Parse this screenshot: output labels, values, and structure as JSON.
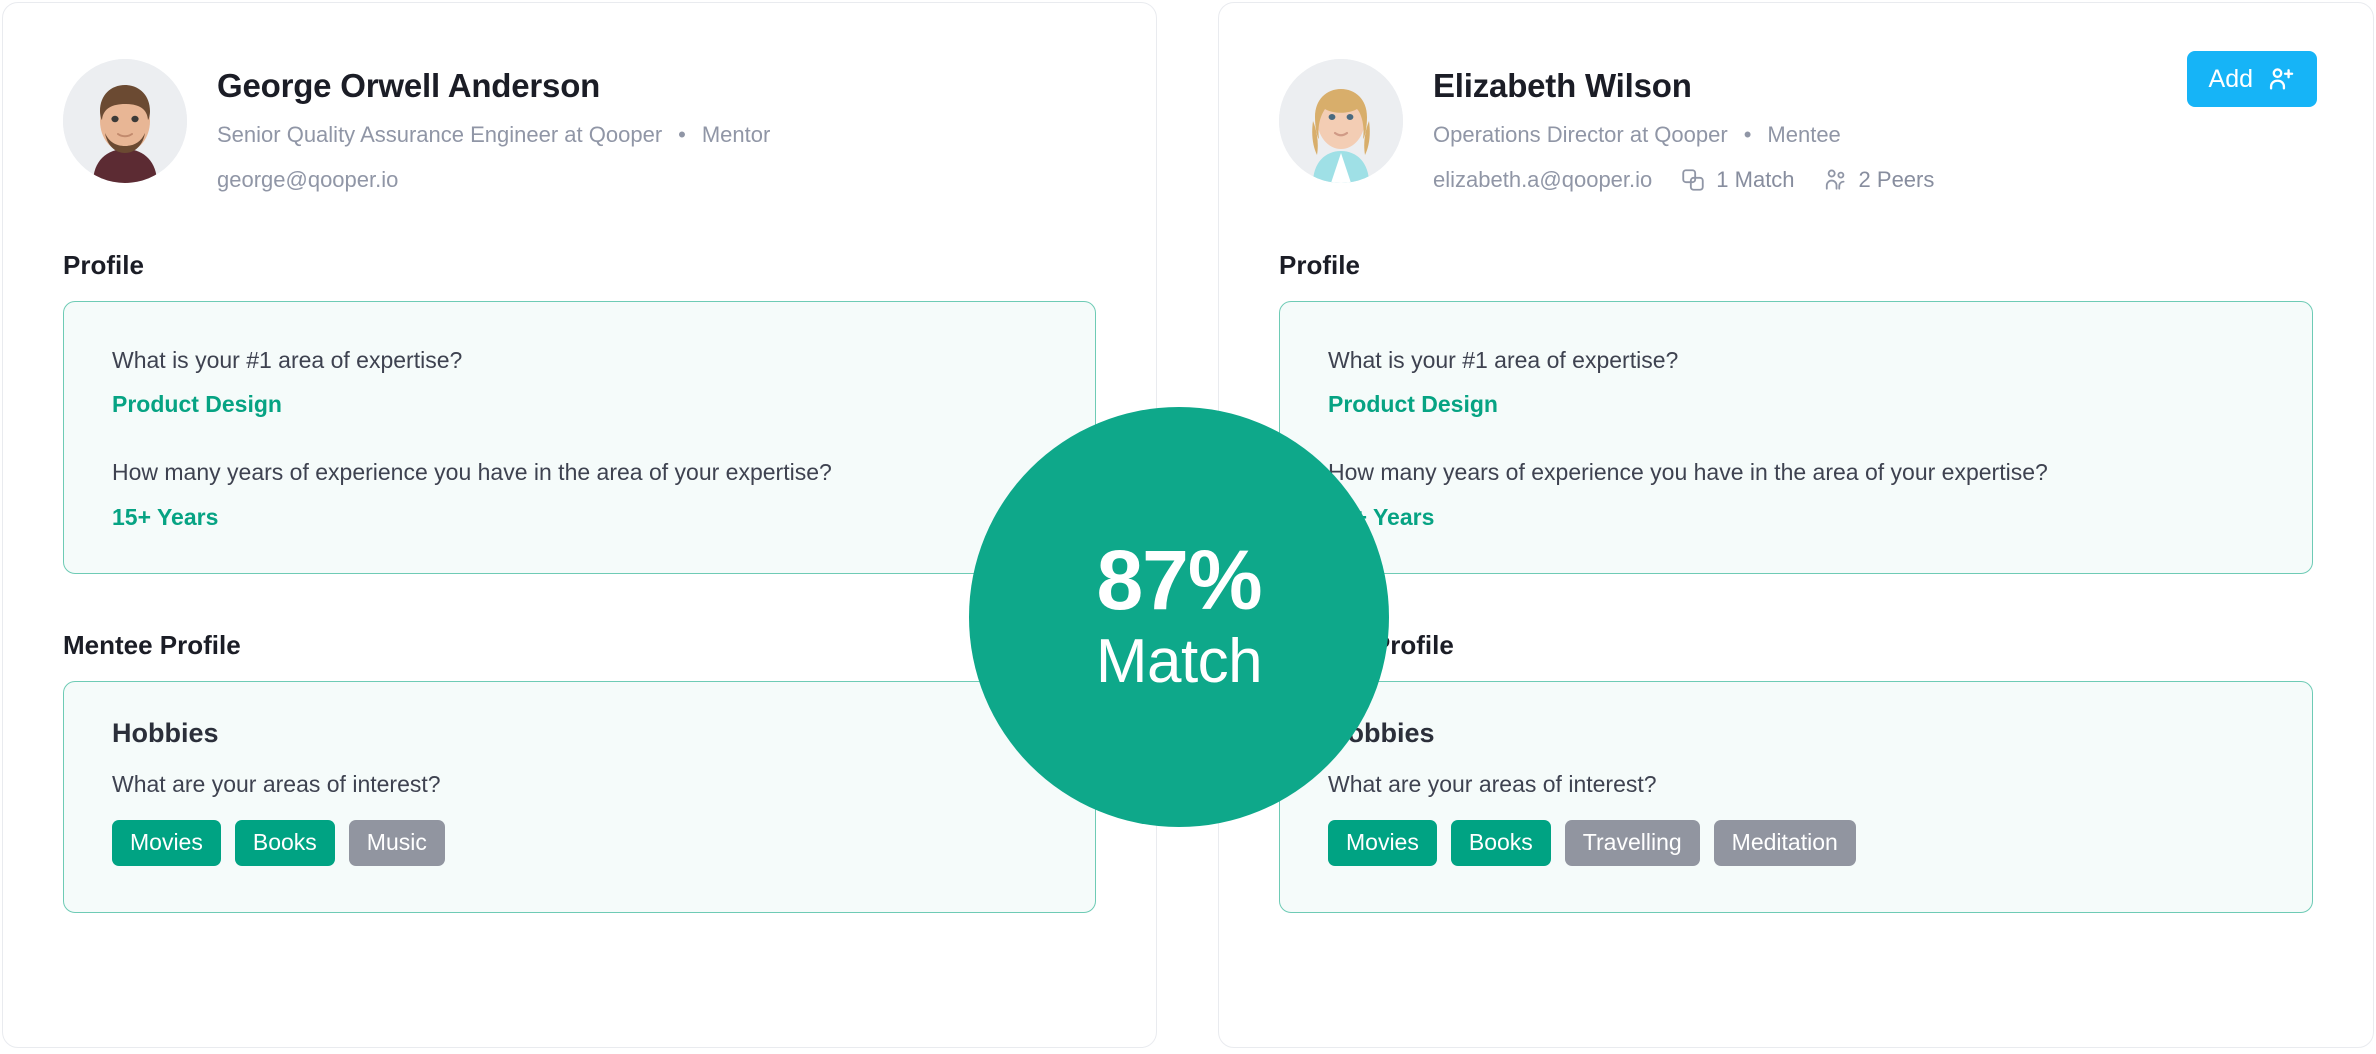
{
  "colors": {
    "accent_teal": "#0ea88a",
    "tag_match": "#00a383",
    "tag_plain": "#9195a0",
    "add_button_blue": "#16b4f7",
    "qbox_border": "#6ecbb5",
    "qbox_bg": "#f5fbfa",
    "muted_text": "#9096a6"
  },
  "match": {
    "percent": "87%",
    "label": "Match"
  },
  "left_card": {
    "name": "George Orwell Anderson",
    "title": "Senior Quality Assurance Engineer at Qooper",
    "separator": "•",
    "role": "Mentor",
    "email": "george@qooper.io",
    "profile_section_title": "Profile",
    "profile_questions": [
      {
        "question": "What is your #1 area of expertise?",
        "answer": "Product Design"
      },
      {
        "question": "How many years of experience you have in the area of your expertise?",
        "answer": "15+ Years"
      }
    ],
    "counterpart_section_title": "Mentee Profile",
    "hobbies": {
      "title": "Hobbies",
      "question": "What are your areas of interest?",
      "tags": [
        {
          "label": "Movies",
          "matched": true
        },
        {
          "label": "Books",
          "matched": true
        },
        {
          "label": "Music",
          "matched": false
        }
      ]
    }
  },
  "right_card": {
    "name": "Elizabeth Wilson",
    "title": "Operations Director at Qooper",
    "separator": "•",
    "role": "Mentee",
    "email": "elizabeth.a@qooper.io",
    "stats": [
      {
        "icon": "match-icon",
        "label": "1 Match"
      },
      {
        "icon": "peers-icon",
        "label": "2 Peers"
      }
    ],
    "add_button": {
      "label": "Add",
      "icon": "person-plus-icon"
    },
    "profile_section_title": "Profile",
    "profile_questions": [
      {
        "question": "What is your #1 area of expertise?",
        "answer": "Product Design"
      },
      {
        "question": "How many years of experience you have in the area of your expertise?",
        "answer": "15+ Years"
      }
    ],
    "counterpart_section_title": "Mentor Profile",
    "hobbies": {
      "title": "Hobbies",
      "question": "What are your areas of interest?",
      "tags": [
        {
          "label": "Movies",
          "matched": true
        },
        {
          "label": "Books",
          "matched": true
        },
        {
          "label": "Travelling",
          "matched": false
        },
        {
          "label": "Meditation",
          "matched": false
        }
      ]
    }
  }
}
